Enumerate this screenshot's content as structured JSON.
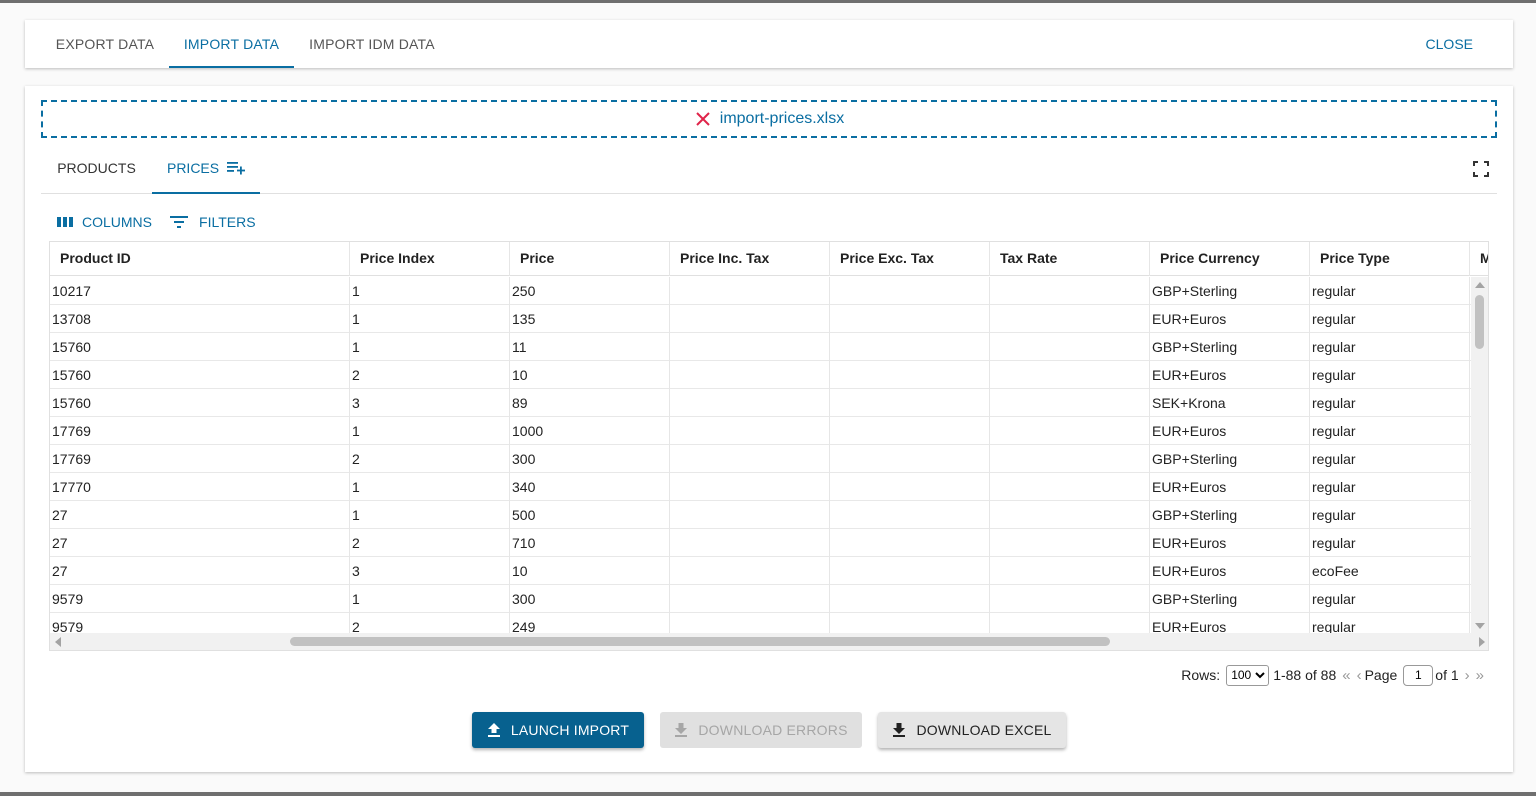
{
  "top_tabs": [
    {
      "label": "EXPORT DATA"
    },
    {
      "label": "IMPORT DATA"
    },
    {
      "label": "IMPORT IDM DATA"
    }
  ],
  "active_top_tab": "IMPORT DATA",
  "close_label": "CLOSE",
  "dropzone": {
    "filename": "import-prices.xlsx"
  },
  "sub_tabs": [
    {
      "label": "PRODUCTS"
    },
    {
      "label": "PRICES"
    }
  ],
  "active_sub_tab": "PRICES",
  "toolbar": {
    "columns_label": "COLUMNS",
    "filters_label": "FILTERS"
  },
  "grid": {
    "columns": [
      "Product ID",
      "Price Index",
      "Price",
      "Price Inc. Tax",
      "Price Exc. Tax",
      "Tax Rate",
      "Price Currency",
      "Price Type",
      "M"
    ],
    "rows": [
      [
        "10217",
        "1",
        "250",
        "",
        "",
        "",
        "GBP+Sterling",
        "regular"
      ],
      [
        "13708",
        "1",
        "135",
        "",
        "",
        "",
        "EUR+Euros",
        "regular"
      ],
      [
        "15760",
        "1",
        "11",
        "",
        "",
        "",
        "GBP+Sterling",
        "regular"
      ],
      [
        "15760",
        "2",
        "10",
        "",
        "",
        "",
        "EUR+Euros",
        "regular"
      ],
      [
        "15760",
        "3",
        "89",
        "",
        "",
        "",
        "SEK+Krona",
        "regular"
      ],
      [
        "17769",
        "1",
        "1000",
        "",
        "",
        "",
        "EUR+Euros",
        "regular"
      ],
      [
        "17769",
        "2",
        "300",
        "",
        "",
        "",
        "GBP+Sterling",
        "regular"
      ],
      [
        "17770",
        "1",
        "340",
        "",
        "",
        "",
        "EUR+Euros",
        "regular"
      ],
      [
        "27",
        "1",
        "500",
        "",
        "",
        "",
        "GBP+Sterling",
        "regular"
      ],
      [
        "27",
        "2",
        "710",
        "",
        "",
        "",
        "EUR+Euros",
        "regular"
      ],
      [
        "27",
        "3",
        "10",
        "",
        "",
        "",
        "EUR+Euros",
        "ecoFee"
      ],
      [
        "9579",
        "1",
        "300",
        "",
        "",
        "",
        "GBP+Sterling",
        "regular"
      ],
      [
        "9579",
        "2",
        "249",
        "",
        "",
        "",
        "EUR+Euros",
        "regular"
      ]
    ]
  },
  "pagination": {
    "rows_label": "Rows:",
    "rows_per_page": "100",
    "range_text": "1-88 of 88",
    "page_label": "Page",
    "page_value": "1",
    "of_text": "of 1"
  },
  "buttons": {
    "launch_import": "LAUNCH IMPORT",
    "download_errors": "DOWNLOAD ERRORS",
    "download_excel": "DOWNLOAD EXCEL"
  },
  "colors": {
    "accent": "#0a6ea2",
    "primary_button": "#07618f",
    "remove_icon": "#e0244a"
  },
  "icons": {
    "remove_file": "close-icon",
    "prices_tab": "playlist-add-icon",
    "fullscreen": "fullscreen-icon",
    "columns": "view-column-icon",
    "filters": "filter-list-icon",
    "launch": "upload-icon",
    "download": "download-icon"
  }
}
